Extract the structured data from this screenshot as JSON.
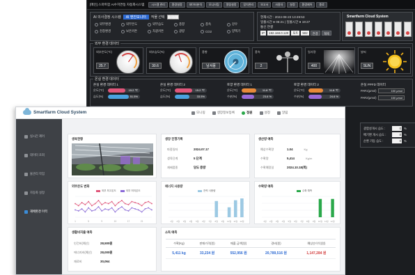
{
  "back": {
    "title": "[메인] 스마트팜 AI수치연동 자동화시스템",
    "toolbar": [
      "시스템 관리",
      "환경설정",
      "데이터분석",
      "모니터링",
      "알림설정",
      "장치관리",
      "보고서",
      "사용자",
      "설정",
      "환경제어",
      "종료"
    ],
    "select_label": "AI 의사결정 시스템",
    "select_active": "AI 엔진모니터",
    "select_target_label": "작물 선택",
    "select_target_value": "딸기",
    "checks": [
      "외부환경",
      "외부온도",
      "외부습도",
      "풍향",
      "풍속",
      "강우",
      "천창환경",
      "보온커튼",
      "차광커튼",
      "광량",
      "CO2",
      "양액기"
    ],
    "weather": {
      "line1": "현재시간 : 2024-08-23 13:49:53",
      "line2": "일출시간 ● 06:21 | 일몰시간 ● 19:27",
      "ip_label": "통신 연결",
      "ip_fields": [
        "IP",
        "192.168.0.120",
        "포트",
        "502"
      ],
      "ip_buttons": [
        "연결",
        "해제"
      ]
    },
    "brand": "Smartfarm Cloud System",
    "brand_icon_count": 7,
    "sensor_section": "외부 환경 데이터",
    "sensors": [
      {
        "label": "외부온도(℃)",
        "value": "25.7",
        "kind": "dial"
      },
      {
        "label": "외부습도(%)",
        "value": "30.6",
        "kind": "dial"
      },
      {
        "label": "풍향",
        "value": "남서풍",
        "kind": "compass"
      },
      {
        "label": "풍속",
        "value": "2",
        "kind": "anemometer"
      },
      {
        "label": "일사량",
        "value": "400",
        "kind": "rays"
      },
      {
        "label": "날씨",
        "value": "SUN",
        "kind": "sun"
      }
    ],
    "env_section": "온실 환경 데이터",
    "env_cards": [
      {
        "title": "온실 환경 데이터 1",
        "rows": [
          {
            "label": "온도(℃)",
            "value": "15.2 ℃",
            "pct": 0.55,
            "color": "#e0567a"
          },
          {
            "label": "습도(%)",
            "value": "51.5%",
            "pct": 0.65,
            "color": "#4aa3e0"
          }
        ]
      },
      {
        "title": "온실 환경 데이터 2",
        "rows": [
          {
            "label": "온도(℃)",
            "value": "15.2 ℃",
            "pct": 0.55,
            "color": "#e0567a"
          },
          {
            "label": "습도(%)",
            "value": "33.5%",
            "pct": 0.45,
            "color": "#4aa3e0"
          }
        ]
      },
      {
        "title": "토양 환경 데이터 1",
        "rows": [
          {
            "label": "온도(℃)",
            "value": "11.8 ℃",
            "pct": 0.45,
            "color": "#e88a3a"
          },
          {
            "label": "수분(%)",
            "value": "23.6 %",
            "pct": 0.4,
            "color": "#9a6ad8"
          }
        ]
      },
      {
        "title": "토양 환경 데이터 2",
        "rows": [
          {
            "label": "온도(℃)",
            "value": "11.8 ℃",
            "pct": 0.45,
            "color": "#e88a3a"
          },
          {
            "label": "수분(%)",
            "value": "24.6 %",
            "pct": 0.42,
            "color": "#9a6ad8"
          }
        ]
      }
    ],
    "par": {
      "title": "온실 PPFD 데이터",
      "rows": [
        {
          "label": "PAR1(μmol)",
          "value": "150 μmol"
        },
        {
          "label": "PAR2(μmol)",
          "value": "150 μmol"
        }
      ]
    },
    "extra": [
      {
        "label": "광합성개시 습도 :",
        "value": "0",
        "unit": "%"
      },
      {
        "label": "배기팬 개시 습도 :",
        "value": "0",
        "unit": "%"
      },
      {
        "label": "순환 가동 습도 :",
        "value": "0",
        "unit": "%"
      }
    ]
  },
  "front": {
    "brand": "Smartfarm Cloud System",
    "nav": [
      {
        "label": "모니링",
        "active": false
      },
      {
        "label": "생장정보등록",
        "active": false
      },
      {
        "label": "정원",
        "active": true
      },
      {
        "label": "설정",
        "active": false
      },
      {
        "label": "알림",
        "active": false
      }
    ],
    "side": [
      {
        "label": "실시간 제어",
        "active": false
      },
      {
        "label": "데이터 조회",
        "active": false
      },
      {
        "label": "물관리 작업",
        "active": false
      },
      {
        "label": "자동화 설정",
        "active": false
      },
      {
        "label": "재배환경 이력",
        "active": true
      }
    ],
    "cards": {
      "cctv": "생육현황",
      "crop": {
        "title": "생장 진행기록",
        "rows": [
          {
            "k": "파종일자",
            "v": "2024.07.17"
          },
          {
            "k": "생육단계",
            "v": "5 단계"
          },
          {
            "k": "재배품종",
            "v": "당도 증량"
          }
        ]
      },
      "harvest": {
        "title": "생산량 예측",
        "rows": [
          {
            "k": "예상수확량",
            "v": "1.04",
            "u": "Kg"
          },
          {
            "k": "수확량",
            "v": "5,414",
            "u": "Kg/m"
          },
          {
            "k": "수확예정일",
            "v": "2024.10.18(목)",
            "u": ""
          }
        ]
      },
      "temp": {
        "title": "외부온도 변화",
        "legend": [
          "외부 최고온도",
          "외부 최저온도"
        ]
      },
      "power": {
        "title": "에너지 사용량",
        "legend": [
          "전력 사용량"
        ]
      },
      "water": {
        "title": "수확량 예측",
        "legend": [
          "수확 예측"
        ]
      },
      "consume": {
        "title": "생활비지출 예측",
        "rows": [
          {
            "k": "인건비(예산)",
            "v": "28,500원"
          },
          {
            "k": "에너지비(예산)",
            "v": "28,000원"
          },
          {
            "k": "재료비",
            "v": "30,064"
          }
        ]
      },
      "sales": {
        "title": "소득 예측",
        "headers": [
          "수확(Kg)",
          "판매가격(원)",
          "매출 금액(원)",
          "경비(원)",
          "예상순이익(원)"
        ],
        "values": [
          "5,411 kg",
          "33,234 원",
          "552,956 원",
          "20,789,516 원",
          "1,147,284 원"
        ]
      }
    },
    "chart_data": [
      {
        "type": "line",
        "title": "외부온도 변화",
        "categories": [
          "1",
          "2",
          "3",
          "4",
          "5",
          "6",
          "7",
          "8",
          "9",
          "10",
          "11",
          "12",
          "13",
          "14",
          "15",
          "16",
          "17",
          "18",
          "19",
          "20",
          "21",
          "22",
          "23",
          "24"
        ],
        "series": [
          {
            "name": "외부 최고온도",
            "values": [
              28,
              26,
              29,
              27,
              30,
              26,
              28,
              31,
              27,
              29,
              28,
              30,
              26,
              29,
              31,
              28,
              27,
              30,
              29,
              28,
              26,
              29,
              30,
              28
            ]
          },
          {
            "name": "외부 최저온도",
            "values": [
              22,
              21,
              23,
              20,
              24,
              21,
              22,
              25,
              21,
              23,
              22,
              24,
              20,
              23,
              25,
              22,
              21,
              24,
              23,
              22,
              20,
              23,
              24,
              22
            ]
          }
        ]
      },
      {
        "type": "bar",
        "title": "에너지 사용량",
        "categories": [
          "1월",
          "2월",
          "3월",
          "4월",
          "5월",
          "6월",
          "7월",
          "8월",
          "9월",
          "10월",
          "11월",
          "12월"
        ],
        "series": [
          {
            "name": "전력 사용량",
            "values": [
              0,
              0,
              0,
              0,
              0,
              0,
              0,
              62,
              0,
              38,
              65,
              72
            ]
          }
        ]
      },
      {
        "type": "bar",
        "title": "수확량 예측",
        "categories": [
          "1월",
          "2월",
          "3월",
          "4월",
          "5월",
          "6월",
          "7월",
          "8월",
          "9월",
          "10월",
          "11월",
          "12월"
        ],
        "series": [
          {
            "name": "수확 예측",
            "values": [
              0,
              0,
              0,
              0,
              0,
              0,
              0,
              0,
              0,
              70,
              0,
              70
            ]
          }
        ]
      }
    ]
  },
  "colors": {
    "accent": "#2d6ad2",
    "dark_bg": "#1b1d20",
    "side_bg": "#3e4146",
    "green": "#2aa84a",
    "red": "#d23c3c"
  }
}
